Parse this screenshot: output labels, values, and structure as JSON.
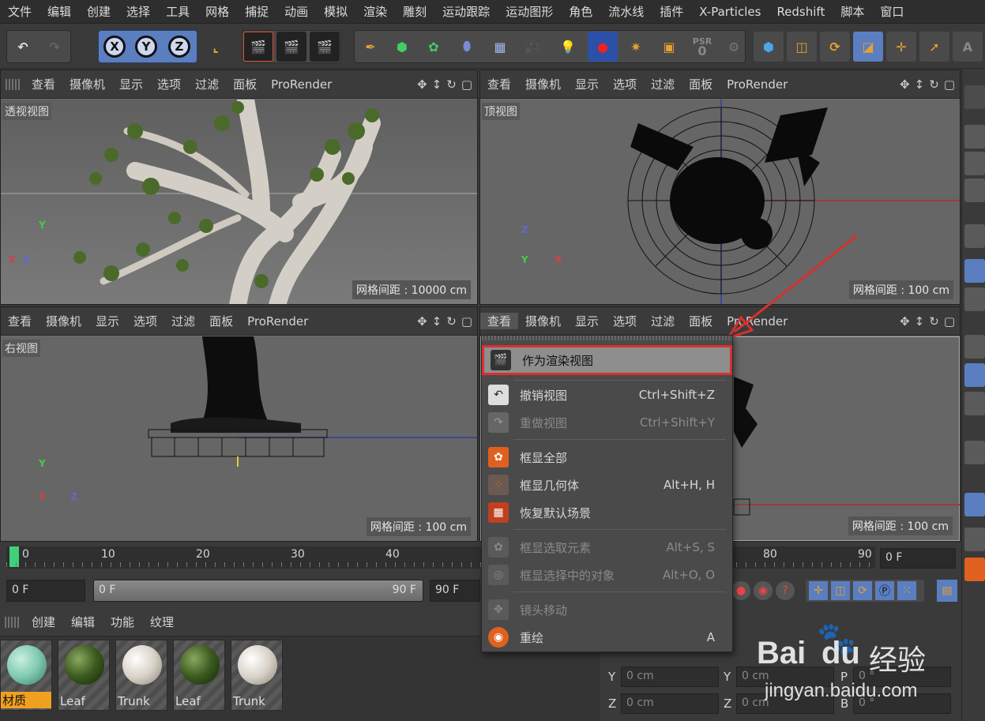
{
  "menubar": [
    "文件",
    "编辑",
    "创建",
    "选择",
    "工具",
    "网格",
    "捕捉",
    "动画",
    "模拟",
    "渲染",
    "雕刻",
    "运动跟踪",
    "运动图形",
    "角色",
    "流水线",
    "插件",
    "X-Particles",
    "Redshift",
    "脚本",
    "窗口"
  ],
  "toolbar": {
    "x_label": "X",
    "y_label": "Y",
    "z_label": "Z",
    "psr_label": "PSR",
    "psr_value": "0"
  },
  "viewport_menu": [
    "查看",
    "摄像机",
    "显示",
    "选项",
    "过滤",
    "面板",
    "ProRender"
  ],
  "viewports": {
    "perspective": {
      "title": "透视视图",
      "grid": "网格间距 : 10000 cm"
    },
    "top": {
      "title": "顶视图",
      "grid": "网格间距 : 100 cm"
    },
    "right": {
      "title": "右视图",
      "grid": "网格间距 : 100 cm"
    },
    "front": {
      "title": "",
      "grid": "网格间距 : 100 cm"
    }
  },
  "axes": {
    "x": "X",
    "y": "Y",
    "z": "Z"
  },
  "context_menu": {
    "items": [
      {
        "label": "作为渲染视图",
        "shortcut": "",
        "disabled": false,
        "highlighted": true,
        "icon": "clapper-icon"
      },
      {
        "label": "撤销视图",
        "shortcut": "Ctrl+Shift+Z",
        "disabled": false,
        "icon": "undo-view-icon"
      },
      {
        "label": "重做视图",
        "shortcut": "Ctrl+Shift+Y",
        "disabled": true,
        "icon": "redo-view-icon"
      },
      {
        "label": "框显全部",
        "shortcut": "",
        "disabled": false,
        "icon": "frame-all-icon"
      },
      {
        "label": "框显几何体",
        "shortcut": "Alt+H, H",
        "disabled": false,
        "icon": "frame-geometry-icon"
      },
      {
        "label": "恢复默认场景",
        "shortcut": "",
        "disabled": false,
        "icon": "reset-scene-icon"
      },
      {
        "label": "框显选取元素",
        "shortcut": "Alt+S, S",
        "disabled": true,
        "icon": "frame-selected-icon"
      },
      {
        "label": "框显选择中的对象",
        "shortcut": "Alt+O, O",
        "disabled": true,
        "icon": "frame-objects-icon"
      },
      {
        "label": "镜头移动",
        "shortcut": "",
        "disabled": true,
        "icon": "camera-move-icon"
      },
      {
        "label": "重绘",
        "shortcut": "A",
        "disabled": false,
        "icon": "redraw-icon"
      }
    ]
  },
  "timeline": {
    "ticks": [
      "0",
      "10",
      "20",
      "30",
      "40",
      "80",
      "90"
    ],
    "current_frame": "0 F",
    "start_frame": "0 F",
    "range_start": "0 F",
    "range_end": "90 F",
    "end_frame": "90 F"
  },
  "material_panel": {
    "menu": [
      "创建",
      "编辑",
      "功能",
      "纹理"
    ],
    "materials": [
      {
        "name": "材质",
        "color": "#7fc9b0",
        "selected": true
      },
      {
        "name": "Leaf",
        "color": "#3a5a1e"
      },
      {
        "name": "Trunk",
        "color": "#d8d2c8"
      },
      {
        "name": "Leaf",
        "color": "#3a5a1e"
      },
      {
        "name": "Trunk",
        "color": "#d8d2c8"
      }
    ]
  },
  "attributes": {
    "rows": [
      {
        "axis": "Y",
        "value": "0 cm",
        "axis2": "Y",
        "value2": "0 cm",
        "axis3": "P",
        "value3": "0 °"
      },
      {
        "axis": "Z",
        "value": "0 cm",
        "axis2": "Z",
        "value2": "0 cm",
        "axis3": "B",
        "value3": "0 °"
      }
    ]
  },
  "watermark": {
    "brand": "Bai",
    "brand2": "du",
    "suffix": "经验",
    "url": "jingyan.baidu.com"
  },
  "colors": {
    "highlight_border": "#d83030",
    "accent_blue": "#5a7ec0",
    "timeline_marker": "#3fd07a"
  }
}
